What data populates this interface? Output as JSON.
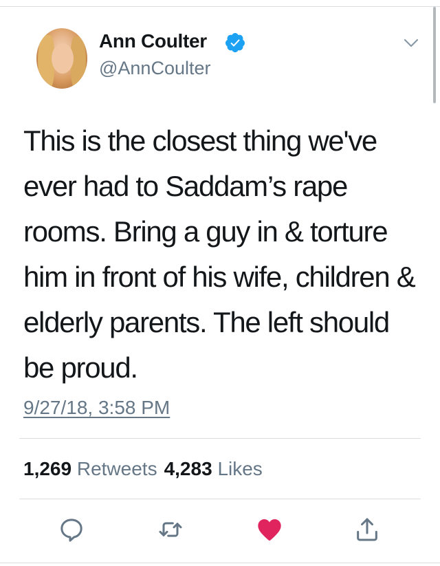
{
  "tweet": {
    "display_name": "Ann Coulter",
    "handle": "@AnnCoulter",
    "text": "This is the closest thing we've ever had to Saddam’s rape rooms. Bring a guy in & torture him in front of his wife, children & elderly parents. The left should be proud.",
    "timestamp": "9/27/18, 3:58 PM",
    "retweets_count": "1,269",
    "retweets_label": "Retweets",
    "likes_count": "4,283",
    "likes_label": "Likes"
  },
  "icons": {
    "verified": "verified-badge-icon",
    "menu": "chevron-down-icon",
    "reply": "reply-icon",
    "retweet": "retweet-icon",
    "like": "heart-icon",
    "share": "share-icon"
  },
  "colors": {
    "verified_blue": "#1da1f2",
    "liked_red": "#e0245e",
    "secondary_text": "#657786",
    "icon_gray": "#657786"
  }
}
